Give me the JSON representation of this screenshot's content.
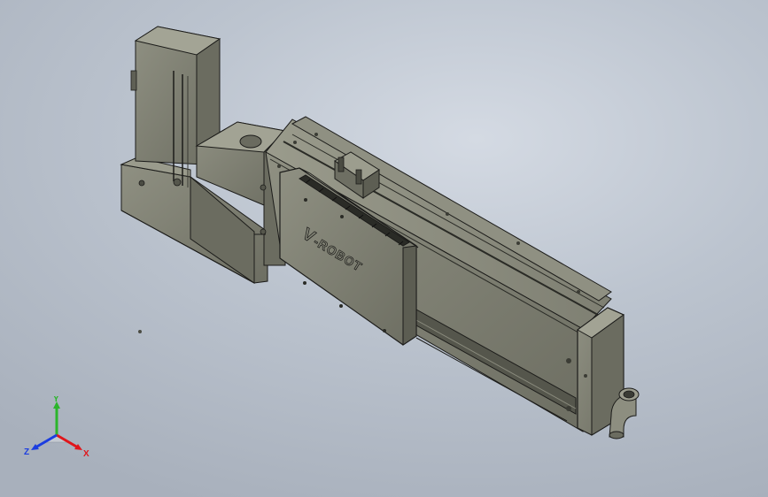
{
  "viewport": {
    "background_top": "#d4dae3",
    "background_bottom": "#a8b0bc"
  },
  "model": {
    "logo_text": "-ROBOT",
    "logo_mark": "V",
    "body_color": "#76776a",
    "body_light": "#8d8e80",
    "body_dark": "#4f5047",
    "edge_color": "#1c1c1a"
  },
  "triad": {
    "x_label": "X",
    "y_label": "Y",
    "z_label": "Z",
    "x_color": "#e0161b",
    "y_color": "#2bb52b",
    "z_color": "#1b3de0"
  }
}
